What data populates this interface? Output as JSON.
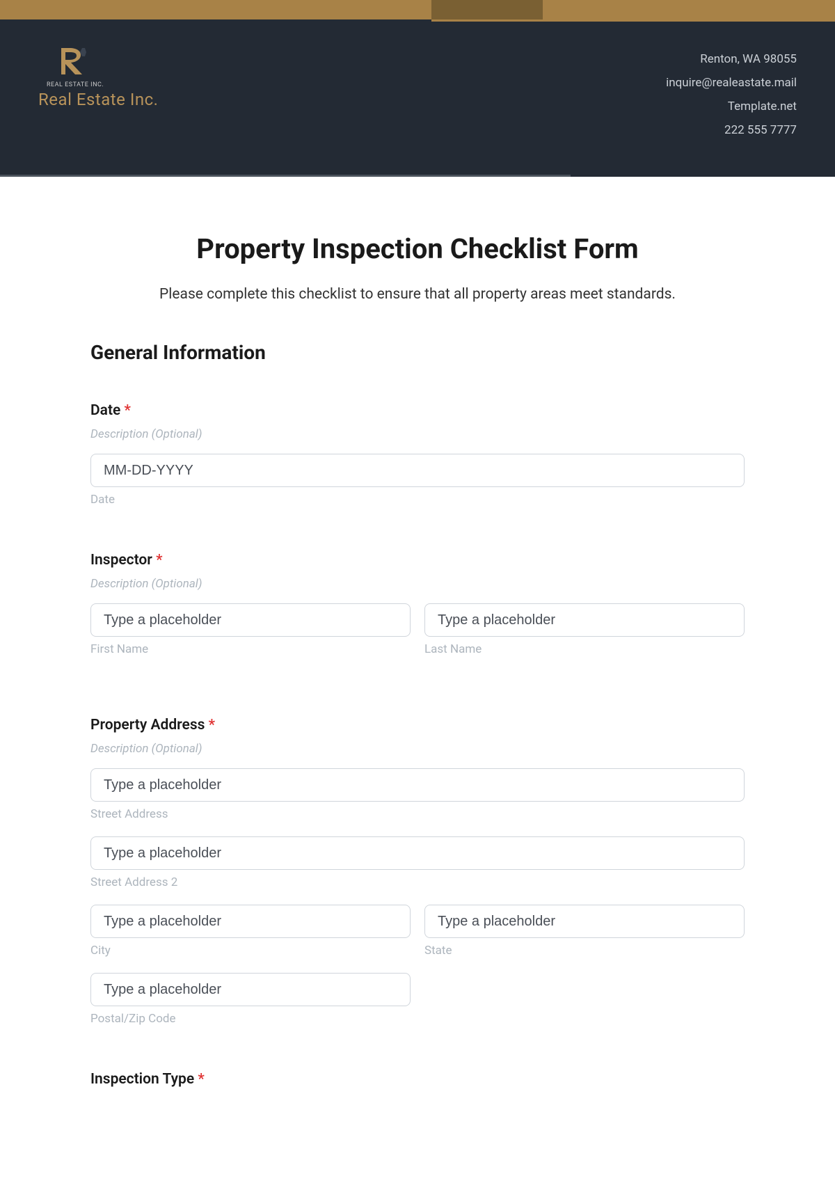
{
  "header": {
    "logo_subtext": "REAL ESTATE INC.",
    "company_name": "Real Estate Inc.",
    "contact": {
      "address": "Renton, WA 98055",
      "email": "inquire@realeastate.mail",
      "website": "Template.net",
      "phone": "222 555 7777"
    }
  },
  "form": {
    "title": "Property Inspection Checklist Form",
    "subtitle": "Please complete this checklist to ensure that all property areas meet standards.",
    "section_general": "General Information",
    "description_placeholder": "Description (Optional)",
    "generic_placeholder": "Type a placeholder",
    "date": {
      "label": "Date",
      "placeholder": "MM-DD-YYYY",
      "sublabel": "Date"
    },
    "inspector": {
      "label": "Inspector",
      "first_name_sublabel": "First Name",
      "last_name_sublabel": "Last Name"
    },
    "address": {
      "label": "Property Address",
      "street1_sublabel": "Street Address",
      "street2_sublabel": "Street Address 2",
      "city_sublabel": "City",
      "state_sublabel": "State",
      "postal_sublabel": "Postal/Zip Code"
    },
    "inspection_type": {
      "label": "Inspection Type"
    }
  }
}
